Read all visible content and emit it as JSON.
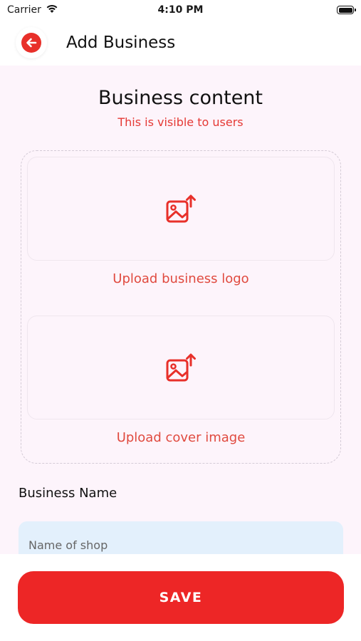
{
  "status_bar": {
    "carrier": "Carrier",
    "time": "4:10 PM",
    "icons": {
      "wifi": "wifi-icon",
      "battery": "battery-icon"
    }
  },
  "header": {
    "title": "Add Business",
    "back_icon": "arrow-left-icon"
  },
  "content": {
    "title": "Business content",
    "subtitle": "This is visible to users",
    "upload_logo": {
      "label": "Upload business logo",
      "icon": "image-upload-icon"
    },
    "upload_cover": {
      "label": "Upload cover image",
      "icon": "image-upload-icon"
    },
    "business_name": {
      "label": "Business Name",
      "placeholder": "Name of shop",
      "value": ""
    }
  },
  "footer": {
    "save_label": "SAVE"
  },
  "colors": {
    "accent": "#ed2626",
    "accent_text": "#e04a3f",
    "content_bg": "#fdf4fb",
    "input_bg": "#e3f0fc"
  }
}
